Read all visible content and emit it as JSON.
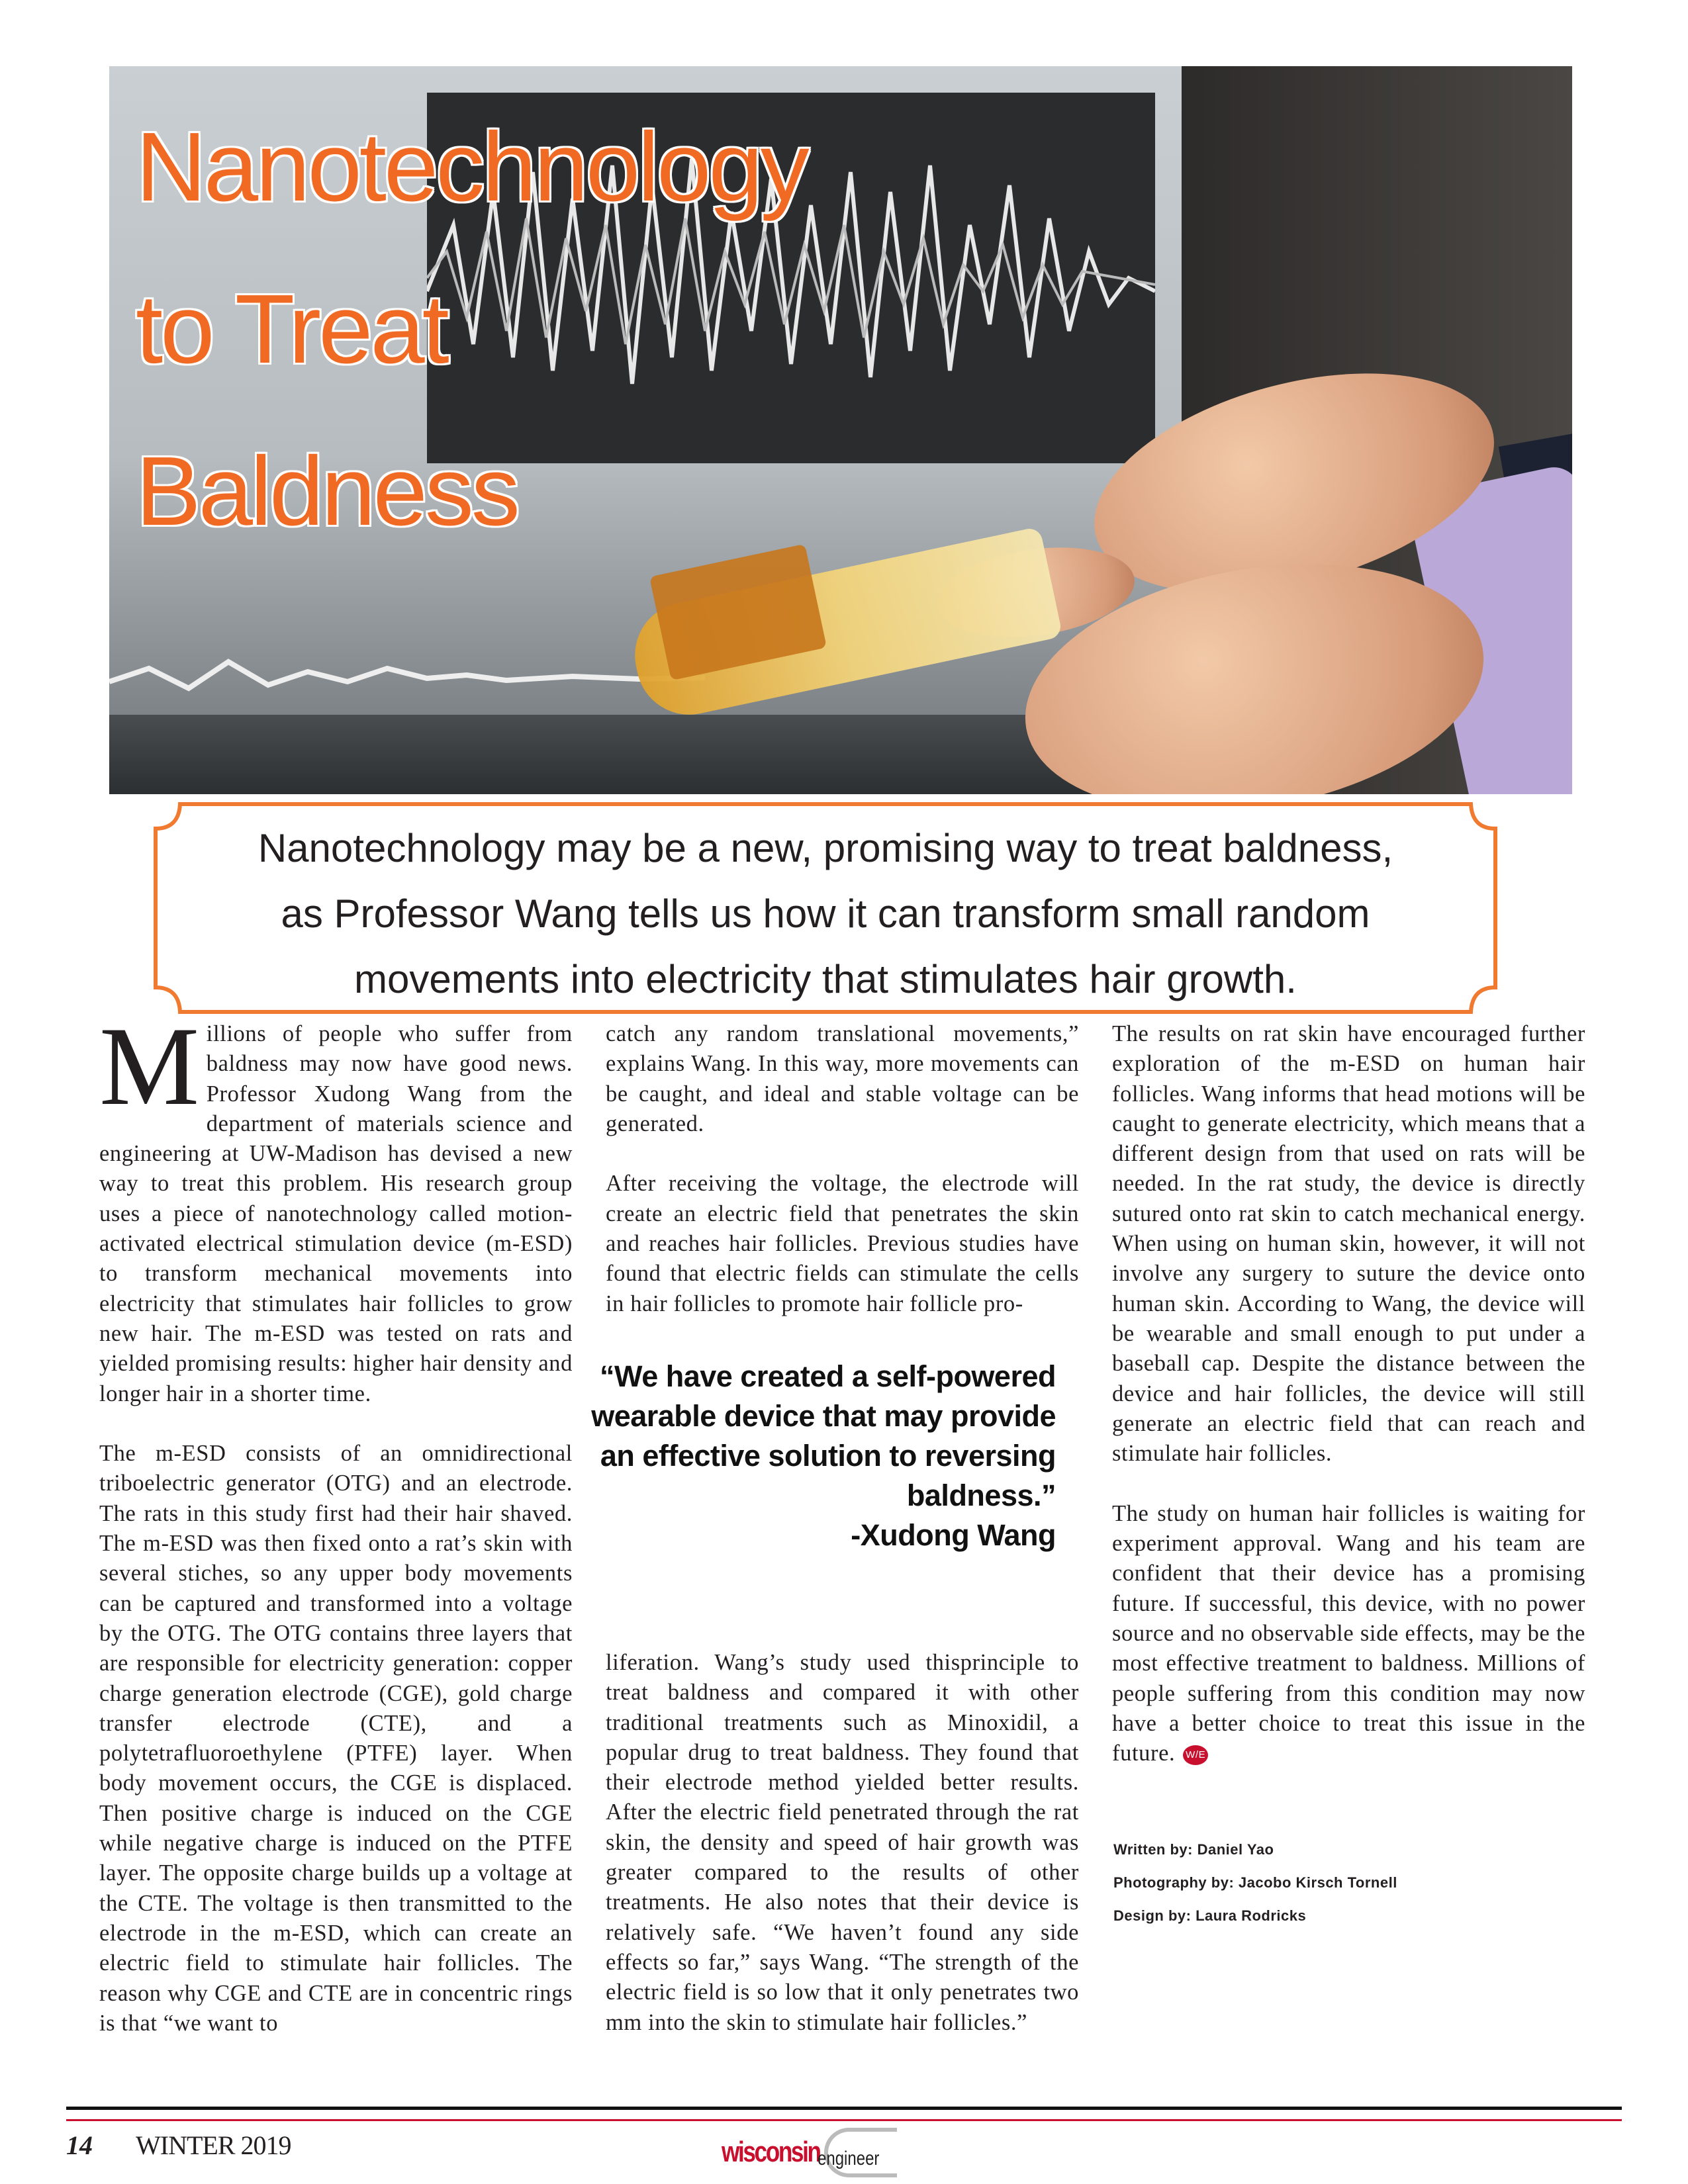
{
  "title_lines": [
    "Nanotechnology",
    "to Treat",
    "Baldness"
  ],
  "callout_lines": [
    "Nanotechnology may be a new, promising way to treat baldness,",
    "as Professor Wang tells us how it can transform small random",
    "movements into electricity that stimulates hair growth."
  ],
  "column1": {
    "drop_cap": "M",
    "paragraphs": [
      "illions of people who suffer from baldness may now have good news. Professor Xudong Wang from the department of materials science and engineering at UW-Madison has devised a new way to treat this problem. His research group uses a piece of nanotechnology called motion-activated electrical stimulation device (m-ESD) to transform mechanical movements into electricity that stimulates hair follicles to grow new hair. The m-ESD was tested on rats and yielded promising results: higher hair density and longer hair in a shorter time.",
      "The m-ESD consists of an omnidirectional triboelectric generator (OTG) and an electrode. The rats in this study first had their hair shaved. The m-ESD was then fixed onto a rat’s skin with several stiches, so any upper body movements can be captured and transformed into a voltage by the OTG. The OTG contains three layers that are responsible for electricity generation: copper charge generation electrode (CGE), gold charge transfer electrode (CTE), and a polytetrafluoroethylene (PTFE) layer. When body movement occurs, the CGE is displaced. Then positive charge is induced on the CGE while negative charge is induced on the PTFE layer. The opposite charge builds up a voltage at the CTE. The voltage is then transmitted to the electrode in the m-ESD, which can create an electric field to stimulate hair follicles. The reason why CGE and CTE are in concentric rings is that “we want to"
    ]
  },
  "column2_top": {
    "paragraphs": [
      "catch any random translational movements,” explains Wang. In this way, more movements can be caught, and ideal and stable voltage can be generated.",
      "After receiving the voltage, the electrode will create an electric field that penetrates the skin and reaches hair follicles. Previous studies have found that electric fields can stimulate the cells in hair follicles to promote hair follicle pro-"
    ]
  },
  "pull_quote": {
    "text": "“We have created a self-powered wearable device that may provide an effective solution to reversing baldness.”",
    "attribution": "-Xudong Wang"
  },
  "column2_bottom": {
    "paragraphs": [
      "liferation. Wang’s study used thisprinciple to treat baldness and compared it with other traditional treatments such as Minoxidil, a popular drug to treat baldness. They found that their electrode method yielded better results. After the electric field penetrated through the rat skin, the density and speed of hair growth was greater compared to the results of other treatments. He also notes that their device is relatively safe. “We haven’t found any side effects so far,” says Wang. “The strength of the electric field is so low that it only penetrates two mm into the skin to stimulate hair follicles.”"
    ]
  },
  "column3": {
    "paragraphs": [
      "The results on rat skin have encouraged further exploration of the m-ESD on human hair follicles. Wang informs that head motions will be caught to generate electricity, which means that a different design from that used on rats will be needed. In the rat study, the device is directly sutured onto rat skin to catch mechanical energy. When using on human skin, however, it will not involve any surgery to suture the device onto human skin. According to Wang, the device will be wearable and small enough to put under a baseball cap. Despite the distance between the device and hair follicles, the device will still generate an electric field that can reach and stimulate hair follicles.",
      "The study on human hair follicles is waiting for experiment approval. Wang and his team are confident that their device has a promising future. If successful, this device, with no power source and no observable side effects, may be the most effective treatment to baldness. Millions of people suffering from this condition may now have a better choice to treat this issue in the future."
    ],
    "end_mark": "W/E"
  },
  "credits": [
    "Written by: Daniel Yao",
    "Photography by: Jacobo Kirsch Tornell",
    "Design by: Laura Rodricks"
  ],
  "footer": {
    "page_number": "14",
    "issue": "WINTER 2019",
    "logo_primary": "wisconsin",
    "logo_secondary": "engineer"
  },
  "colors": {
    "title_orange": "#f06a24",
    "accent_red": "#c8102e",
    "callout_border": "#f07a30"
  }
}
